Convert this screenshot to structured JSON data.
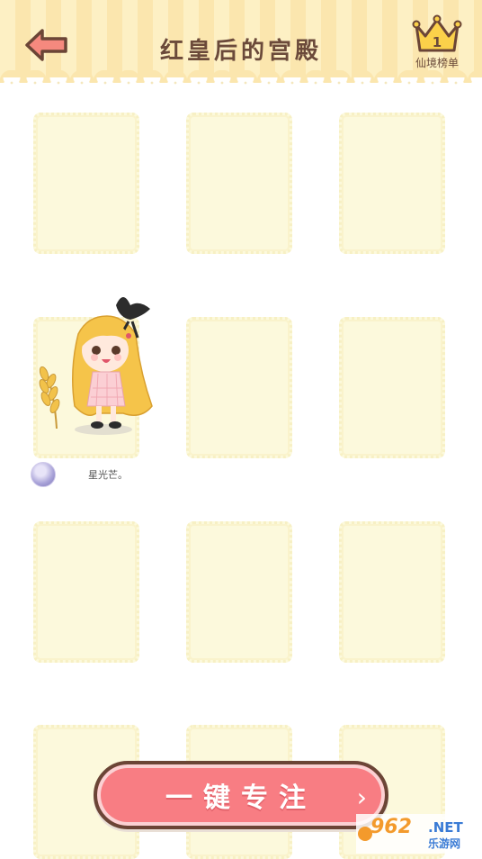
{
  "header": {
    "title": "红皇后的宫殿",
    "back_icon": "back-arrow-icon",
    "ranking": {
      "label": "仙境榜单",
      "rank": "1",
      "icon": "crown-icon"
    }
  },
  "grid": {
    "rows": 4,
    "cols": 3,
    "occupied": {
      "row": 2,
      "col": 1,
      "owner_name": "星光芒。",
      "avatar_icon": "avatar-icon",
      "figure_icon": "doll-character-icon"
    }
  },
  "focus_button": {
    "label": "一键专注",
    "icon": "chevron-right-icon"
  },
  "watermark": {
    "main": "962",
    "net": ".NET",
    "sub": "乐游网"
  },
  "colors": {
    "header_stripe_a": "#fdf0c4",
    "header_stripe_b": "#fbe6ae",
    "frame_fill": "#fcf9dc",
    "button_fill": "#f87d83",
    "button_border": "#6b4536",
    "title_text": "#6b4a3a"
  }
}
